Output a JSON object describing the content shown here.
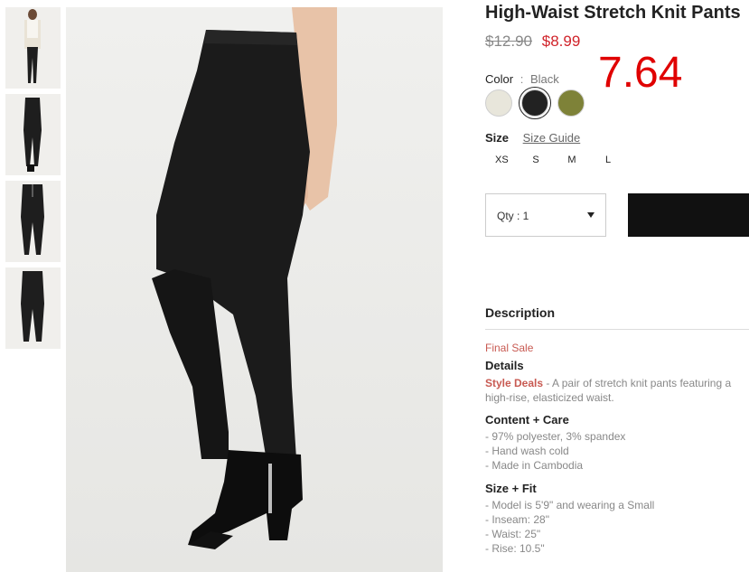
{
  "product": {
    "title": "High-Waist Stretch Knit Pants",
    "price_original": "$12.90",
    "price_sale": "$8.99",
    "annotation": "7.64"
  },
  "color": {
    "label": "Color",
    "separator": ":",
    "selected": "Black",
    "swatches": [
      {
        "name": "Cream",
        "hex": "#e8e6db"
      },
      {
        "name": "Black",
        "hex": "#222222"
      },
      {
        "name": "Olive",
        "hex": "#7e8238"
      }
    ]
  },
  "size": {
    "label": "Size",
    "guide_label": "Size Guide",
    "options": [
      "XS",
      "S",
      "M",
      "L"
    ]
  },
  "quantity": {
    "label": "Qty : 1"
  },
  "description": {
    "heading": "Description",
    "final_sale": "Final Sale",
    "details_heading": "Details",
    "style_deals": "Style Deals",
    "details_text": " - A pair of stretch knit pants featuring a high-rise, elasticized waist.",
    "content_heading": "Content + Care",
    "content_items": [
      "- 97% polyester, 3% spandex",
      "- Hand wash cold",
      "- Made in Cambodia"
    ],
    "fit_heading": "Size + Fit",
    "fit_items": [
      "- Model is 5'9\" and wearing a Small",
      "- Inseam: 28\"",
      "- Waist: 25\"",
      "- Rise: 10.5\""
    ]
  },
  "colors": {
    "sale_red": "#d0232a",
    "accent_rose": "#c85a52",
    "button_black": "#111111"
  }
}
